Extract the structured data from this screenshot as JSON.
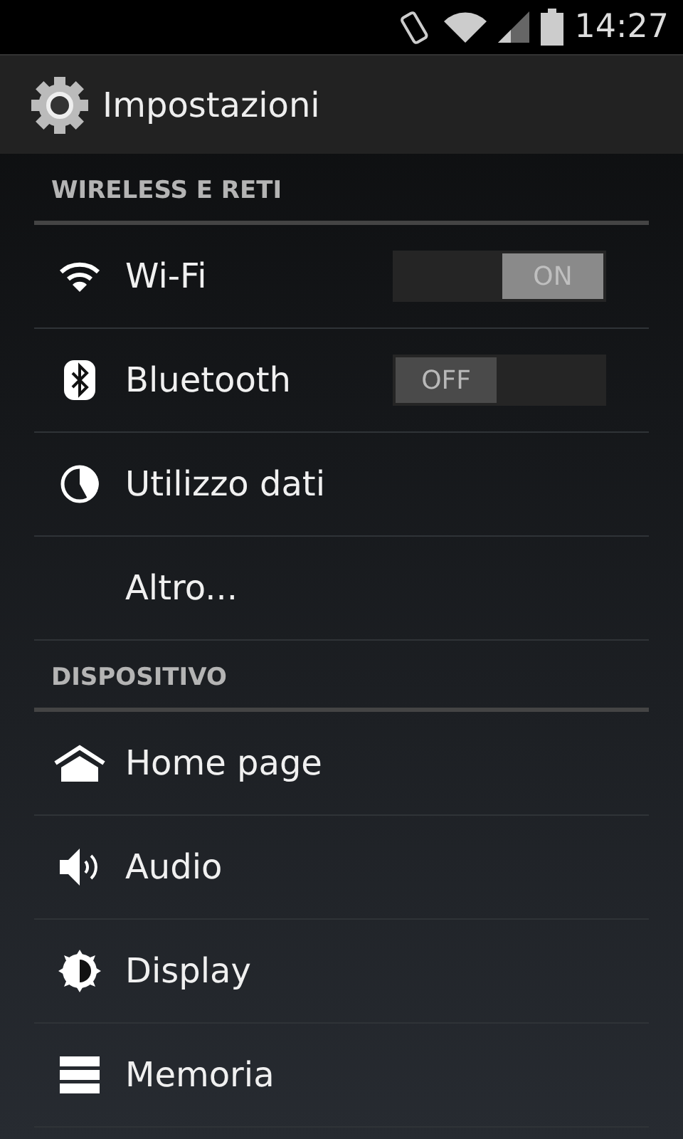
{
  "status_bar": {
    "time": "14:27"
  },
  "action_bar": {
    "title": "Impostazioni"
  },
  "sections": [
    {
      "title": "WIRELESS E RETI",
      "items": [
        {
          "label": "Wi-Fi",
          "switch": {
            "on": true,
            "label": "ON"
          }
        },
        {
          "label": "Bluetooth",
          "switch": {
            "on": false,
            "label": "OFF"
          }
        },
        {
          "label": "Utilizzo dati"
        },
        {
          "label": "Altro..."
        }
      ]
    },
    {
      "title": "DISPOSITIVO",
      "items": [
        {
          "label": "Home page"
        },
        {
          "label": "Audio"
        },
        {
          "label": "Display"
        },
        {
          "label": "Memoria"
        }
      ]
    }
  ]
}
